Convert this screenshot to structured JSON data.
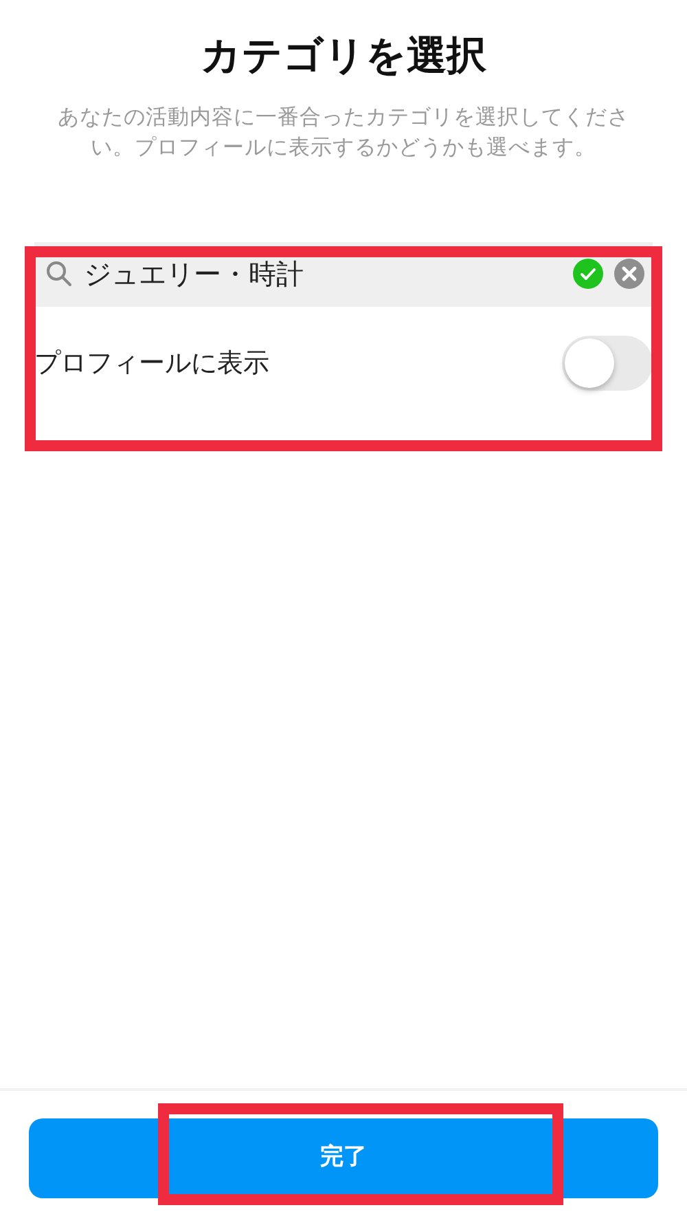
{
  "title": "カテゴリを選択",
  "description": "あなたの活動内容に一番合ったカテゴリを選択してください。プロフィールに表示するかどうかも選べます。",
  "search": {
    "value": "ジュエリー・時計",
    "verified": true
  },
  "display_toggle": {
    "label": "プロフィールに表示",
    "on": false
  },
  "done_button": "完了"
}
